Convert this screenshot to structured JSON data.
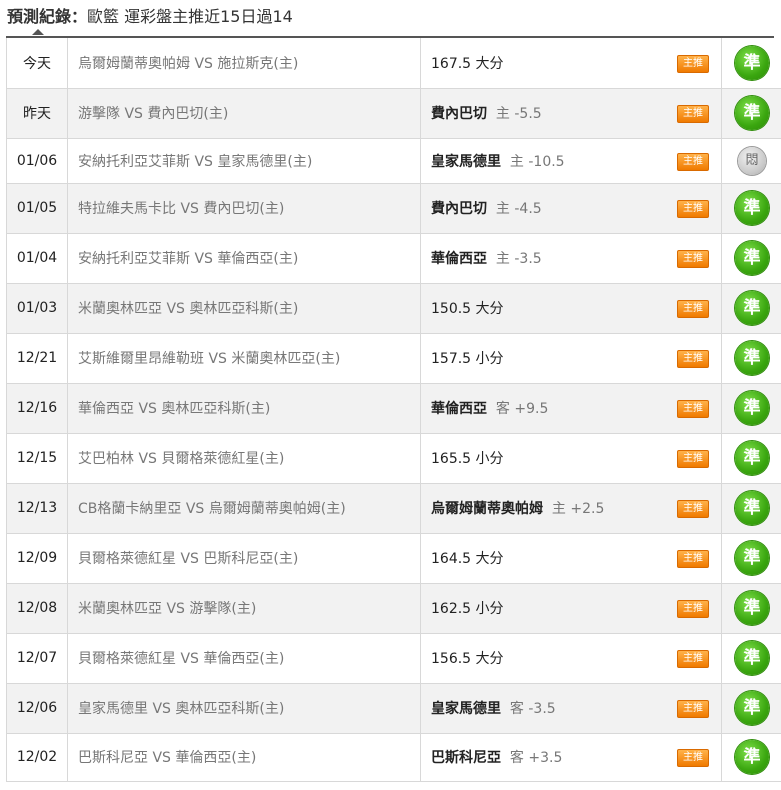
{
  "header": {
    "label": "預測紀錄：",
    "text": "歐籃 運彩盤主推近15日過14"
  },
  "badge_label": "主推",
  "rows": [
    {
      "date": "今天",
      "match": "烏爾姆蘭蒂奧帕姆 VS 施拉斯克(主)",
      "pick_team": "",
      "pick_line": "",
      "pick_total": "167.5 大分",
      "result": "準",
      "status": "win"
    },
    {
      "date": "昨天",
      "match": "游擊隊 VS 費內巴切(主)",
      "pick_team": "費內巴切",
      "pick_line": "主 -5.5",
      "pick_total": "",
      "result": "準",
      "status": "win"
    },
    {
      "date": "01/06",
      "match": "安納托利亞艾菲斯 VS 皇家馬德里(主)",
      "pick_team": "皇家馬德里",
      "pick_line": "主 -10.5",
      "pick_total": "",
      "result": "悶",
      "status": "push"
    },
    {
      "date": "01/05",
      "match": "特拉維夫馬卡比 VS 費內巴切(主)",
      "pick_team": "費內巴切",
      "pick_line": "主 -4.5",
      "pick_total": "",
      "result": "準",
      "status": "win"
    },
    {
      "date": "01/04",
      "match": "安納托利亞艾菲斯 VS 華倫西亞(主)",
      "pick_team": "華倫西亞",
      "pick_line": "主 -3.5",
      "pick_total": "",
      "result": "準",
      "status": "win"
    },
    {
      "date": "01/03",
      "match": "米蘭奧林匹亞 VS 奧林匹亞科斯(主)",
      "pick_team": "",
      "pick_line": "",
      "pick_total": "150.5 大分",
      "result": "準",
      "status": "win"
    },
    {
      "date": "12/21",
      "match": "艾斯維爾里昂維勒班 VS 米蘭奧林匹亞(主)",
      "pick_team": "",
      "pick_line": "",
      "pick_total": "157.5 小分",
      "result": "準",
      "status": "win"
    },
    {
      "date": "12/16",
      "match": "華倫西亞 VS 奧林匹亞科斯(主)",
      "pick_team": "華倫西亞",
      "pick_line": "客 +9.5",
      "pick_total": "",
      "result": "準",
      "status": "win"
    },
    {
      "date": "12/15",
      "match": "艾巴柏林 VS 貝爾格萊德紅星(主)",
      "pick_team": "",
      "pick_line": "",
      "pick_total": "165.5 小分",
      "result": "準",
      "status": "win"
    },
    {
      "date": "12/13",
      "match": "CB格蘭卡納里亞 VS 烏爾姆蘭蒂奧帕姆(主)",
      "pick_team": "烏爾姆蘭蒂奧帕姆",
      "pick_line": "主 +2.5",
      "pick_total": "",
      "result": "準",
      "status": "win"
    },
    {
      "date": "12/09",
      "match": "貝爾格萊德紅星 VS 巴斯科尼亞(主)",
      "pick_team": "",
      "pick_line": "",
      "pick_total": "164.5 大分",
      "result": "準",
      "status": "win"
    },
    {
      "date": "12/08",
      "match": "米蘭奧林匹亞 VS 游擊隊(主)",
      "pick_team": "",
      "pick_line": "",
      "pick_total": "162.5 小分",
      "result": "準",
      "status": "win"
    },
    {
      "date": "12/07",
      "match": "貝爾格萊德紅星 VS 華倫西亞(主)",
      "pick_team": "",
      "pick_line": "",
      "pick_total": "156.5 大分",
      "result": "準",
      "status": "win"
    },
    {
      "date": "12/06",
      "match": "皇家馬德里 VS 奧林匹亞科斯(主)",
      "pick_team": "皇家馬德里",
      "pick_line": "客 -3.5",
      "pick_total": "",
      "result": "準",
      "status": "win"
    },
    {
      "date": "12/02",
      "match": "巴斯科尼亞 VS 華倫西亞(主)",
      "pick_team": "巴斯科尼亞",
      "pick_line": "客 +3.5",
      "pick_total": "",
      "result": "準",
      "status": "win"
    }
  ],
  "colors": {
    "win": "#3aa60f",
    "push": "#c8c8c8",
    "badge": "#f07a00"
  }
}
